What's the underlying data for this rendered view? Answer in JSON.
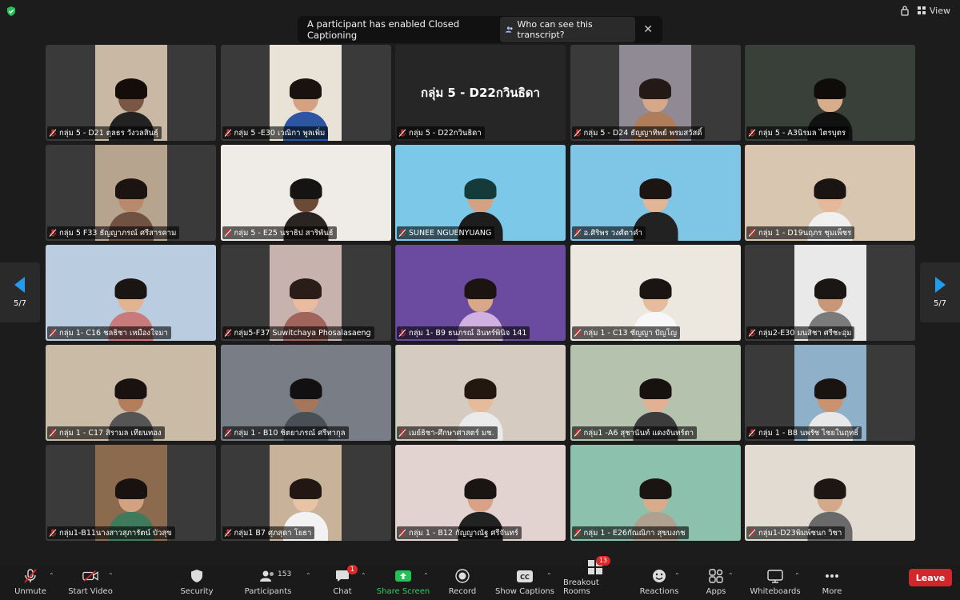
{
  "banner": {
    "message": "A participant has enabled Closed Captioning",
    "who_label": "Who can see this transcript?"
  },
  "top_right": {
    "view_label": "View"
  },
  "pager": {
    "left_label": "5/7",
    "right_label": "5/7"
  },
  "tiles": [
    {
      "name": "กลุ่ม 5 - D21 ตุลธร วังวลสินธุ์",
      "bg": "#3a3a3a",
      "video": "#c9b9a4",
      "skin": "#7a5644",
      "hair": "#140d09",
      "shirt": "#222222"
    },
    {
      "name": "กลุ่ม 5 -E30 เวณิกา พูลเพิ่ม",
      "bg": "#3a3a3a",
      "video": "#e8e3d6",
      "skin": "#d4a282",
      "hair": "#1a1210",
      "shirt": "#2c56a4"
    },
    {
      "name": "กลุ่ม 5 - D22กวินธิดา",
      "display_name": "กลุ่ม 5 - D22กวินธิดา",
      "bg": "#262626"
    },
    {
      "name": "กลุ่ม 5 - D24 ธัญญาทิพย์ พรมสวัสดิ์",
      "bg": "#3a3a3a",
      "video": "#8f8a93",
      "skin": "#d6a889",
      "hair": "#241914",
      "shirt": "#b07d5a"
    },
    {
      "name": "กลุ่ม 5 - A3นิรมล ไตรบุตร",
      "bg": "#2e3330",
      "video": "#39403a",
      "skin": "#d7ad8c",
      "hair": "#0f0c0b",
      "shirt": "#111111",
      "wide": true
    },
    {
      "name": "กลุ่ม 5 F33 ธัญญาภรณ์ ศรีสารคาม",
      "bg": "#3a3a3a",
      "video": "#b7a48f",
      "skin": "#b88a6b",
      "hair": "#1b1411",
      "shirt": "#6f5242"
    },
    {
      "name": "กลุ่ม 5 - E25 นราธิป สาริพันธ์",
      "bg": "#e8e6e1",
      "video": "#efece7",
      "skin": "#6b4a37",
      "hair": "#161413",
      "shirt": "#2a2522",
      "wide": true
    },
    {
      "name": "SUNEE NGUENYUANG",
      "bg": "#7bc8e8",
      "video": "#7bc8e8",
      "skin": "#d4a086",
      "hair": "#143a3a",
      "shirt": "#1d1d1d",
      "wide": true
    },
    {
      "name": "อ.ศิริพร วงศ์ตาคำ",
      "bg": "#7fc6e6",
      "video": "#7fc6e6",
      "skin": "#e2b596",
      "hair": "#1c1512",
      "shirt": "#222222",
      "wide": true
    },
    {
      "name": "กลุ่ม 1 - D19นฤภร ชุมเพ็ชร",
      "bg": "#c9b39a",
      "video": "#d8c6b1",
      "skin": "#e5b89a",
      "hair": "#1a1412",
      "shirt": "#f0f0f0",
      "wide": true
    },
    {
      "name": "กลุ่ม 1- C16 ชลธิชา เหมืองใจมา",
      "bg": "#c6d7e8",
      "video": "#b9cce0",
      "skin": "#e0b393",
      "hair": "#1a1412",
      "shirt": "#c97a7a",
      "wide": true
    },
    {
      "name": "กลุ่ม5-F37 Suwitchaya Phosalasaeng",
      "bg": "#3a3a3a",
      "video": "#c8b2ae",
      "skin": "#e9bba0",
      "hair": "#2a1d18",
      "shirt": "#a0645a"
    },
    {
      "name": "กลุ่ม 1- B9 ธนภรณ์ อินทร์พินิจ 141",
      "bg": "#5a3f8e",
      "video": "#6a4ba0",
      "skin": "#d9a888",
      "hair": "#1c1412",
      "shirt": "#d0b0e0",
      "wide": true
    },
    {
      "name": "กลุ่ม 1 - C13 ชัญญา ปัญโญ",
      "bg": "#e8e4dc",
      "video": "#ece8e0",
      "skin": "#e5bc9e",
      "hair": "#1a1412",
      "shirt": "#f7f7f7",
      "wide": true
    },
    {
      "name": "กลุ่ม2-E30 มนสิชา ศรีชะอุ่ม",
      "bg": "#3a3a3a",
      "video": "#e9e9e9",
      "skin": "#c8977a",
      "hair": "#1b1513",
      "shirt": "#7b7b7b"
    },
    {
      "name": "กลุ่ม 1 - C17 สิรามล เทียนทอง",
      "bg": "#bfb29d",
      "video": "#c9bba6",
      "skin": "#b27e5e",
      "hair": "#1a1210",
      "shirt": "#555555",
      "wide": true
    },
    {
      "name": "กลุ่ม 1 - B10 ชิตยาภรณ์ ศรีทากุล",
      "bg": "#6c727c",
      "video": "#787d86",
      "skin": "#a4775d",
      "hair": "#121010",
      "shirt": "#4a4e55",
      "wide": true
    },
    {
      "name": "เมย์ธิชา-ศึกษาศาสตร์ มช.",
      "bg": "#cbbfb5",
      "video": "#d6cbc1",
      "skin": "#e6bb9b",
      "hair": "#23170f",
      "shirt": "#eaeaea",
      "wide": true,
      "speaking": true
    },
    {
      "name": "กลุ่ม1 -A6 สุชานันท์ แดงจันทร์ตา",
      "bg": "#a9b8a4",
      "video": "#b4c2ae",
      "skin": "#e0b293",
      "hair": "#18120f",
      "shirt": "#3c3c3c",
      "wide": true
    },
    {
      "name": "กลุ่ม 1 - B8 นพรัช ไชยในฤทธิ์",
      "bg": "#3a3a3a",
      "video": "#8fb0c9",
      "skin": "#c9936f",
      "hair": "#1a1410",
      "shirt": "#e8e8e8"
    },
    {
      "name": "กลุ่ม1-B11นางสาวสุภารัตน์ บัวสุข",
      "bg": "#3a3a3a",
      "video": "#8c6a4e",
      "skin": "#d2a282",
      "hair": "#1a1210",
      "shirt": "#3f7a5c"
    },
    {
      "name": "กลุ่ม1 B7 ศุภสุดา โยธา",
      "bg": "#3a3a3a",
      "video": "#c9b29a",
      "skin": "#e8c3a4",
      "hair": "#221712",
      "shirt": "#f2f2f2"
    },
    {
      "name": "กลุ่ม 1 - B12 กัญญาณัฐ ศรีจันทร์",
      "bg": "#d9c9c8",
      "video": "#e2d3d1",
      "skin": "#d9a186",
      "hair": "#1a1412",
      "shirt": "#222222",
      "wide": true
    },
    {
      "name": "กลุ่ม 1 - E26กัณณิกา สุขบงกช",
      "bg": "#7fb7a4",
      "video": "#8cc1ae",
      "skin": "#d8ab8b",
      "hair": "#1a1412",
      "shirt": "#b0a090",
      "wide": true
    },
    {
      "name": "กลุ่ม1-D23พิมพ์ชนก วิชา",
      "bg": "#d8d2c8",
      "video": "#e1dbd1",
      "skin": "#d4a98a",
      "hair": "#1e1612",
      "shirt": "#6a6a6a",
      "wide": true
    }
  ],
  "toolbar": {
    "unmute": "Unmute",
    "start_video": "Start Video",
    "security": "Security",
    "participants": "Participants",
    "participants_count": "153",
    "chat": "Chat",
    "chat_badge": "1",
    "share_screen": "Share Screen",
    "record": "Record",
    "show_captions": "Show Captions",
    "breakout_rooms": "Breakout Rooms",
    "breakout_badge": "13",
    "reactions": "Reactions",
    "apps": "Apps",
    "whiteboards": "Whiteboards",
    "more": "More",
    "leave": "Leave"
  },
  "colors": {
    "accent_green": "#2fb551",
    "leave_red": "#d1262b",
    "badge_red": "#e02828"
  }
}
